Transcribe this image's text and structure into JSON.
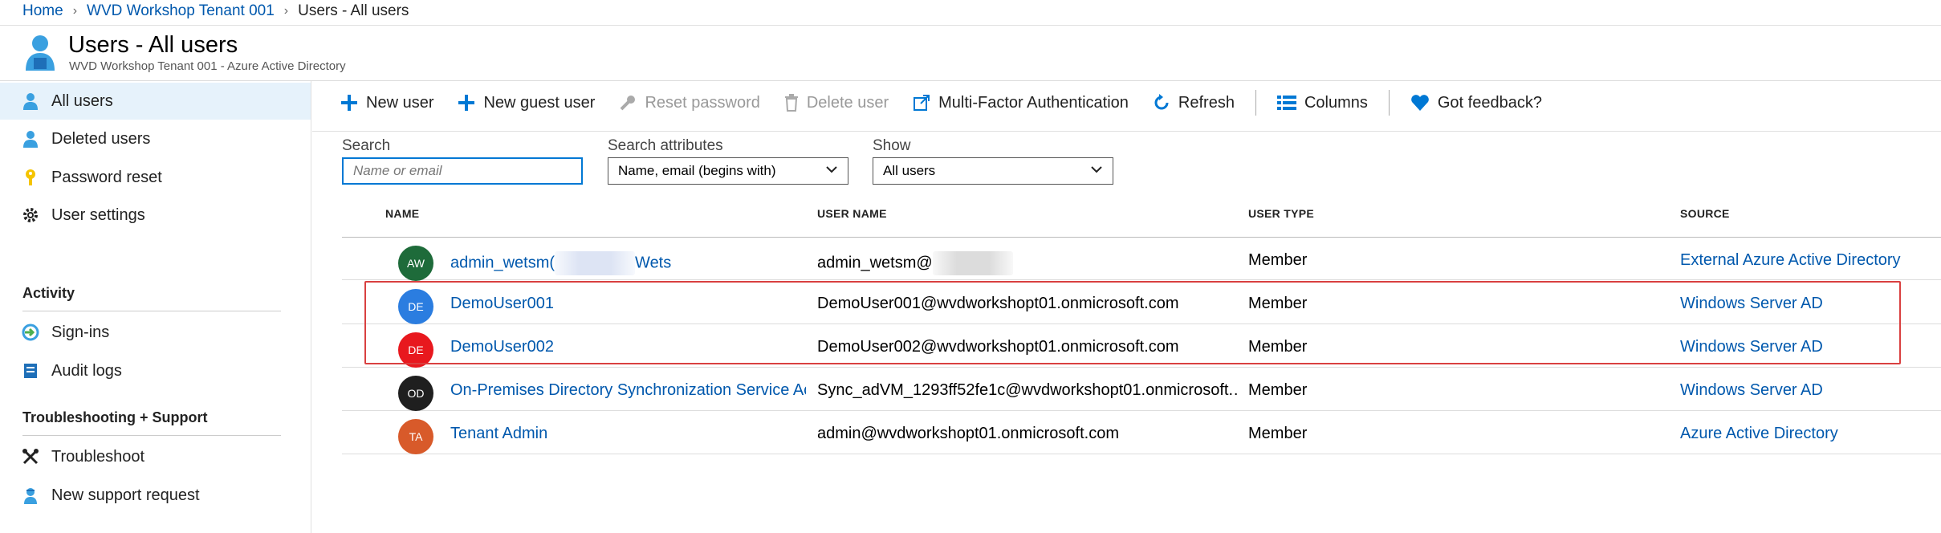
{
  "breadcrumb": [
    "Home",
    "WVD Workshop Tenant 001",
    "Users - All users"
  ],
  "header": {
    "title": "Users - All users",
    "subtitle": "WVD Workshop Tenant 001 - Azure Active Directory"
  },
  "sidebar": {
    "collapse": "«",
    "items": [
      {
        "label": "All users",
        "icon": "user-icon"
      },
      {
        "label": "Deleted users",
        "icon": "user-icon"
      },
      {
        "label": "Password reset",
        "icon": "key-icon"
      },
      {
        "label": "User settings",
        "icon": "gear-icon"
      }
    ],
    "activity_head": "Activity",
    "activity": [
      {
        "label": "Sign-ins",
        "icon": "sign-in-icon"
      },
      {
        "label": "Audit logs",
        "icon": "audit-log-icon"
      }
    ],
    "support_head": "Troubleshooting + Support",
    "support": [
      {
        "label": "Troubleshoot",
        "icon": "wrench-icon"
      },
      {
        "label": "New support request",
        "icon": "support-icon"
      }
    ]
  },
  "toolbar": {
    "new_user": "New user",
    "new_guest_user": "New guest user",
    "reset_password": "Reset password",
    "delete_user": "Delete user",
    "mfa": "Multi-Factor Authentication",
    "refresh": "Refresh",
    "columns": "Columns",
    "feedback": "Got feedback?"
  },
  "filters": {
    "search_label": "Search",
    "search_placeholder": "Name or email",
    "attributes_label": "Search attributes",
    "attributes_value": "Name, email (begins with)",
    "show_label": "Show",
    "show_value": "All users"
  },
  "table": {
    "headers": [
      "NAME",
      "USER NAME",
      "USER TYPE",
      "SOURCE"
    ],
    "rows": [
      {
        "initials": "AW",
        "name_a": "admin_wetsm(",
        "name_b": "Wets",
        "username": "admin_wetsm@",
        "type": "Member",
        "source": "External Azure Active Directory"
      },
      {
        "initials": "DE",
        "name": "DemoUser001",
        "username": "DemoUser001@wvdworkshopt01.onmicrosoft.com",
        "type": "Member",
        "source": "Windows Server AD"
      },
      {
        "initials": "DE",
        "name": "DemoUser002",
        "username": "DemoUser002@wvdworkshopt01.onmicrosoft.com",
        "type": "Member",
        "source": "Windows Server AD"
      },
      {
        "initials": "OD",
        "name": "On-Premises Directory Synchronization Service Ac",
        "username": "Sync_adVM_1293ff52fe1c@wvdworkshopt01.onmicrosoft.…",
        "type": "Member",
        "source": "Windows Server AD"
      },
      {
        "initials": "TA",
        "name": "Tenant Admin",
        "username": "admin@wvdworkshopt01.onmicrosoft.com",
        "type": "Member",
        "source": "Azure Active Directory"
      }
    ]
  },
  "colors": {
    "link": "#0058ad",
    "accent": "#0078d4",
    "avatar_aw": "#1e6b3a",
    "avatar_de1": "#2b7de0",
    "avatar_de2": "#e8181e",
    "avatar_od": "#1f1f1f",
    "avatar_ta": "#d85a2a",
    "highlight": "#d94040"
  }
}
